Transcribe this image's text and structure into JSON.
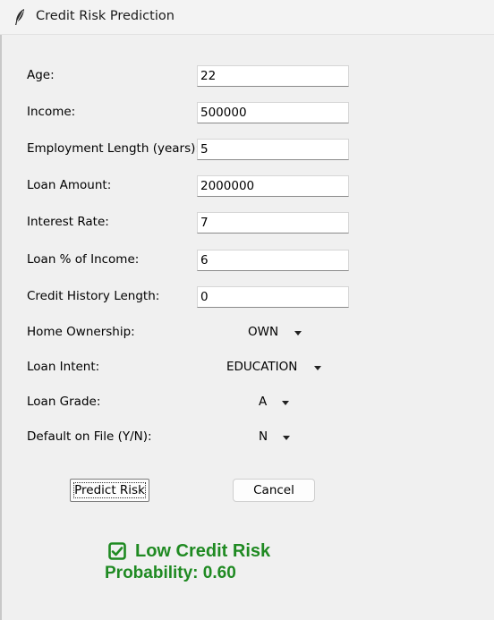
{
  "window": {
    "title": "Credit Risk Prediction",
    "icon": "feather-icon"
  },
  "form": {
    "age": {
      "label": "Age:",
      "value": "22"
    },
    "income": {
      "label": "Income:",
      "value": "500000"
    },
    "employment_length": {
      "label": "Employment Length (years):",
      "value": "5"
    },
    "loan_amount": {
      "label": "Loan Amount:",
      "value": "2000000"
    },
    "interest_rate": {
      "label": "Interest Rate:",
      "value": "7"
    },
    "loan_percent_income": {
      "label": "Loan % of Income:",
      "value": "6"
    },
    "credit_history_length": {
      "label": "Credit History Length:",
      "value": "0"
    },
    "home_ownership": {
      "label": "Home Ownership:",
      "selected": "OWN"
    },
    "loan_intent": {
      "label": "Loan Intent:",
      "selected": "EDUCATION"
    },
    "loan_grade": {
      "label": "Loan Grade:",
      "selected": "A"
    },
    "default_on_file": {
      "label": "Default on File (Y/N):",
      "selected": "N"
    }
  },
  "buttons": {
    "predict": "Predict Risk",
    "cancel": "Cancel"
  },
  "result": {
    "status": "Low Credit Risk",
    "probability": "Probability: 0.60",
    "color": "#1f8a22",
    "icon": "check-box-icon"
  }
}
